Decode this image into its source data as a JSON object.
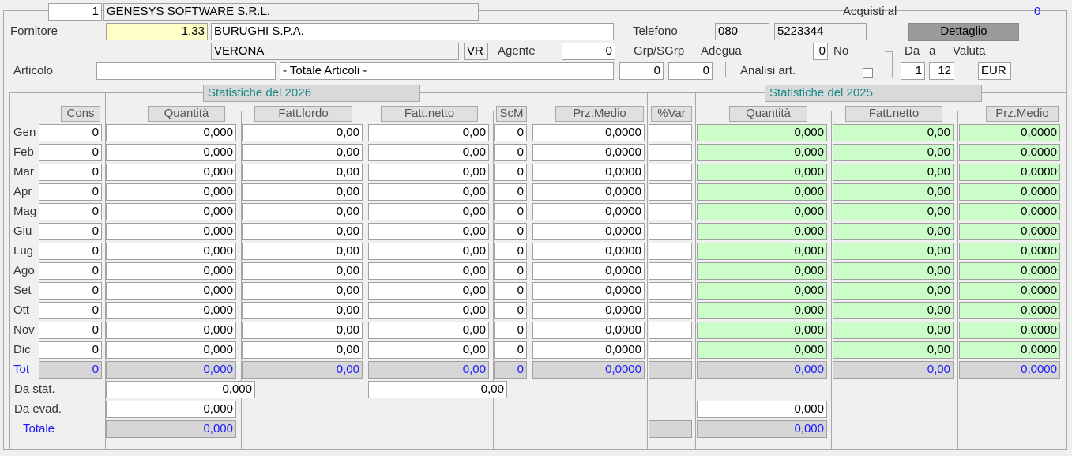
{
  "header": {
    "company_code": "1",
    "company_name": "GENESYS SOFTWARE S.R.L.",
    "acquisti_label": "Acquisti al",
    "acquisti_value": "0"
  },
  "fornitore": {
    "label": "Fornitore",
    "code": "1,33",
    "name": "BURUGHI S.P.A.",
    "city": "VERONA",
    "province": "VR",
    "agente_label": "Agente",
    "agente_value": "0",
    "telefono_label": "Telefono",
    "phone_prefix": "080",
    "phone_number": "5223344",
    "dettaglio_label": "Dettaglio",
    "grp_label": "Grp/SGrp",
    "adegua_label": "Adegua",
    "adegua_value": "0",
    "no_label": "No"
  },
  "articolo": {
    "label": "Articolo",
    "code": "",
    "description": "- Totale Articoli -",
    "grp_value": "0",
    "sgrp_value": "0",
    "analisi_label": "Analisi art.",
    "da_label": "Da",
    "a_label": "a",
    "valuta_label": "Valuta",
    "da_value": "1",
    "a_value": "12",
    "valuta_value": "EUR"
  },
  "stats_current": {
    "title": "Statistiche del 2026",
    "headers": {
      "cons": "Cons",
      "quantita": "Quantità",
      "fatt_lordo": "Fatt.lordo",
      "fatt_netto": "Fatt.netto",
      "scm": "ScM",
      "prz_medio": "Prz.Medio",
      "var": "%Var"
    }
  },
  "stats_previous": {
    "title": "Statistiche del 2025",
    "headers": {
      "quantita": "Quantità",
      "fatt_netto": "Fatt.netto",
      "prz_medio": "Prz.Medio"
    }
  },
  "rows": [
    {
      "month": "Gen",
      "cons": "0",
      "qty": "0,000",
      "lordo": "0,00",
      "netto": "0,00",
      "scm": "0",
      "prz": "0,0000",
      "var": "",
      "p_qty": "0,000",
      "p_netto": "0,00",
      "p_prz": "0,0000"
    },
    {
      "month": "Feb",
      "cons": "0",
      "qty": "0,000",
      "lordo": "0,00",
      "netto": "0,00",
      "scm": "0",
      "prz": "0,0000",
      "var": "",
      "p_qty": "0,000",
      "p_netto": "0,00",
      "p_prz": "0,0000"
    },
    {
      "month": "Mar",
      "cons": "0",
      "qty": "0,000",
      "lordo": "0,00",
      "netto": "0,00",
      "scm": "0",
      "prz": "0,0000",
      "var": "",
      "p_qty": "0,000",
      "p_netto": "0,00",
      "p_prz": "0,0000"
    },
    {
      "month": "Apr",
      "cons": "0",
      "qty": "0,000",
      "lordo": "0,00",
      "netto": "0,00",
      "scm": "0",
      "prz": "0,0000",
      "var": "",
      "p_qty": "0,000",
      "p_netto": "0,00",
      "p_prz": "0,0000"
    },
    {
      "month": "Mag",
      "cons": "0",
      "qty": "0,000",
      "lordo": "0,00",
      "netto": "0,00",
      "scm": "0",
      "prz": "0,0000",
      "var": "",
      "p_qty": "0,000",
      "p_netto": "0,00",
      "p_prz": "0,0000"
    },
    {
      "month": "Giu",
      "cons": "0",
      "qty": "0,000",
      "lordo": "0,00",
      "netto": "0,00",
      "scm": "0",
      "prz": "0,0000",
      "var": "",
      "p_qty": "0,000",
      "p_netto": "0,00",
      "p_prz": "0,0000"
    },
    {
      "month": "Lug",
      "cons": "0",
      "qty": "0,000",
      "lordo": "0,00",
      "netto": "0,00",
      "scm": "0",
      "prz": "0,0000",
      "var": "",
      "p_qty": "0,000",
      "p_netto": "0,00",
      "p_prz": "0,0000"
    },
    {
      "month": "Ago",
      "cons": "0",
      "qty": "0,000",
      "lordo": "0,00",
      "netto": "0,00",
      "scm": "0",
      "prz": "0,0000",
      "var": "",
      "p_qty": "0,000",
      "p_netto": "0,00",
      "p_prz": "0,0000"
    },
    {
      "month": "Set",
      "cons": "0",
      "qty": "0,000",
      "lordo": "0,00",
      "netto": "0,00",
      "scm": "0",
      "prz": "0,0000",
      "var": "",
      "p_qty": "0,000",
      "p_netto": "0,00",
      "p_prz": "0,0000"
    },
    {
      "month": "Ott",
      "cons": "0",
      "qty": "0,000",
      "lordo": "0,00",
      "netto": "0,00",
      "scm": "0",
      "prz": "0,0000",
      "var": "",
      "p_qty": "0,000",
      "p_netto": "0,00",
      "p_prz": "0,0000"
    },
    {
      "month": "Nov",
      "cons": "0",
      "qty": "0,000",
      "lordo": "0,00",
      "netto": "0,00",
      "scm": "0",
      "prz": "0,0000",
      "var": "",
      "p_qty": "0,000",
      "p_netto": "0,00",
      "p_prz": "0,0000"
    },
    {
      "month": "Dic",
      "cons": "0",
      "qty": "0,000",
      "lordo": "0,00",
      "netto": "0,00",
      "scm": "0",
      "prz": "0,0000",
      "var": "",
      "p_qty": "0,000",
      "p_netto": "0,00",
      "p_prz": "0,0000"
    }
  ],
  "totals": {
    "label": "Tot",
    "cons": "0",
    "qty": "0,000",
    "lordo": "0,00",
    "netto": "0,00",
    "scm": "0",
    "prz": "0,0000",
    "var": "",
    "p_qty": "0,000",
    "p_netto": "0,00",
    "p_prz": "0,0000"
  },
  "footer": {
    "da_stat_label": "Da stat.",
    "da_stat_qty": "0,000",
    "da_stat_netto": "0,00",
    "da_evad_label": "Da evad.",
    "da_evad_qty": "0,000",
    "da_evad_p_qty": "0,000",
    "totale_label": "Totale",
    "totale_qty": "0,000",
    "totale_p_qty": "0,000"
  },
  "colors": {
    "yellow_field": "#ffffc8",
    "green_field": "#cbfdc9",
    "label_blue": "#1a1aff",
    "section_teal": "#1a8a8a"
  }
}
